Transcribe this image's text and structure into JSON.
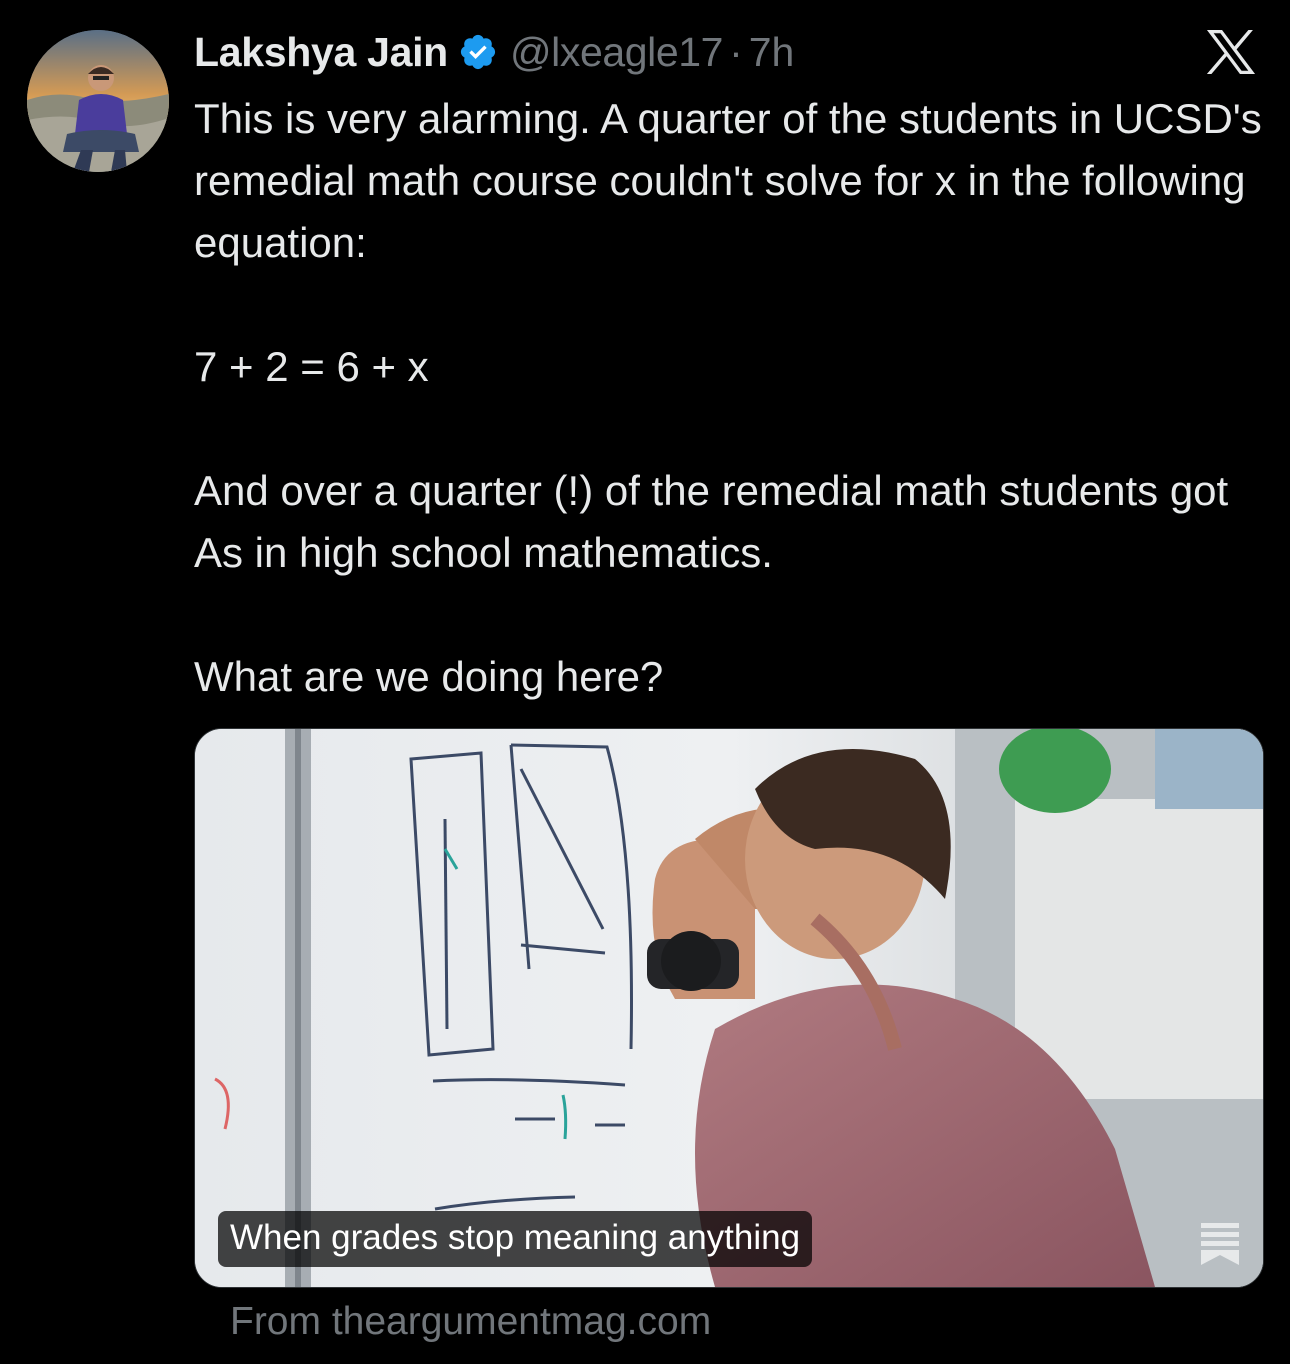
{
  "author": {
    "display_name": "Lakshya Jain",
    "handle": "@lxeagle17",
    "separator": "·",
    "time": "7h",
    "verified": true,
    "avatar": "profile-photo"
  },
  "platform_icon": "x-logo-icon",
  "tweet": {
    "paragraphs": [
      "This is very alarming. A quarter of the students in UCSD's remedial math course couldn't solve for x in the following equation:",
      "7 + 2 = 6 + x",
      "And over a quarter (!) of the remedial math students got As in high school mathematics.",
      "What are we doing here?"
    ]
  },
  "link_card": {
    "title": "When grades stop meaning anything",
    "source": "From theargumentmag.com",
    "image": "student-head-against-whiteboard-photo",
    "icon": "article-icon"
  },
  "colors": {
    "background": "#000000",
    "text": "#e7e9ea",
    "secondary_text": "#71767b",
    "verified_blue": "#1d9bf0"
  }
}
